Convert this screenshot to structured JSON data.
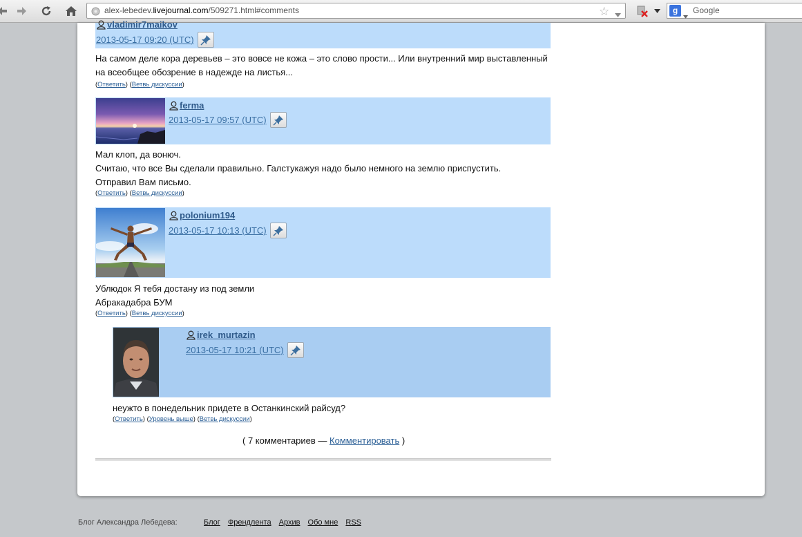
{
  "browser": {
    "url_prefix": "alex-lebedev.",
    "url_domain": "livejournal.com",
    "url_path": "/509271.html#comments",
    "search_placeholder": "Google",
    "search_engine_letter": "g"
  },
  "comments": [
    {
      "username": "vladimir7maikov",
      "date": "2013-05-17 09:20 (UTC)",
      "text": [
        "На самом деле кора деревьев – это вовсе не кожа – это слово прости... Или внутренний мир выставленный",
        "на всеобщее обозрение в надежде на листья..."
      ],
      "links": [
        "Ответить",
        "Ветвь дискуссии"
      ]
    },
    {
      "username": "ferma",
      "date": "2013-05-17 09:57 (UTC)",
      "text": [
        "Мал клоп, да вонюч.",
        "Считаю, что все Вы сделали правильно. Галстукажуя надо было немного на землю приспустить.",
        "Отправил Вам письмо."
      ],
      "links": [
        "Ответить",
        "Ветвь дискуссии"
      ]
    },
    {
      "username": "polonium194",
      "date": "2013-05-17 10:13 (UTC)",
      "text": [
        "Ублюдок Я тебя достану из под земли",
        "Абракадабра БУМ"
      ],
      "links": [
        "Ответить",
        "Ветвь дискуссии"
      ]
    },
    {
      "username": "irek_murtazin",
      "date": "2013-05-17 10:21 (UTC)",
      "text": [
        "неужто в понедельник придете в Останкинский райсуд?"
      ],
      "links": [
        "Ответить",
        "Уровень выше",
        "Ветвь дискуссии"
      ]
    }
  ],
  "summary": {
    "prefix": "( 7 комментариев — ",
    "link": "Комментировать",
    "suffix": " )"
  },
  "footer": {
    "label": "Блог Александра Лебедева:",
    "links": [
      "Блог",
      "Френдлента",
      "Архив",
      "Обо мне",
      "RSS"
    ]
  },
  "colors": {
    "header_bg": "#bcdcfb",
    "nested_header_bg": "#a9cdf2",
    "link": "#2b5f96"
  }
}
